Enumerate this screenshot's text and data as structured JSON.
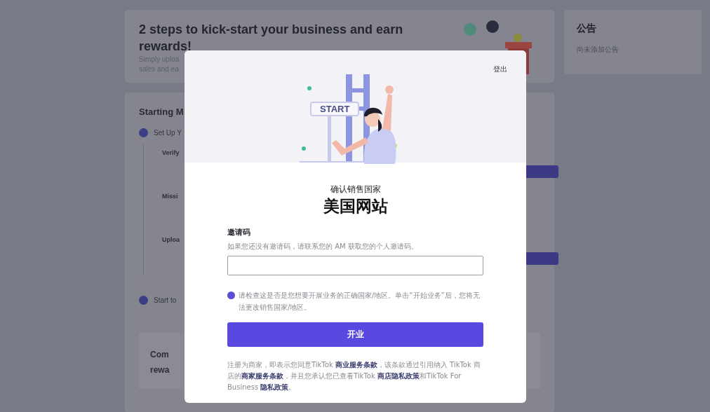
{
  "intro_card": {
    "title": "2 steps to kick-start your business and earn rewards!",
    "text_lines": [
      "Simply uploa",
      "sales and ea"
    ]
  },
  "steps_card": {
    "title": "Starting M",
    "steps": [
      {
        "label": "Set Up Y",
        "tasks": [
          {
            "title": "Verify",
            "has_button": true
          },
          {
            "title": "Missi",
            "has_button": false
          },
          {
            "title": "Uploa",
            "has_button": true
          }
        ]
      },
      {
        "label": "Start to"
      }
    ],
    "promo_lines": [
      "Com",
      "rewa"
    ]
  },
  "announcement": {
    "title": "公告",
    "text": "尚未添加公告"
  },
  "modal": {
    "logout": "登出",
    "sign": "START",
    "subtitle": "确认销售国家",
    "title": "美国网站",
    "invite_label": "邀请码",
    "invite_hint": "如果您还没有邀请码，请联系您的 AM 获取您的个人邀请码。",
    "notice": "请检查这是否是您想要开展业务的正确国家/地区。单击“开始业务”后，您将无法更改销售国家/地区。",
    "button": "开业",
    "terms": "注册为商家，即表示您同意TikTok **商业服务条款**，该条款通过引用纳入 TikTok 商店的**商家服务条款**，并且您承认您已查看TikTok **商店隐私政策**和TikTok For Business **隐私政策**。"
  }
}
